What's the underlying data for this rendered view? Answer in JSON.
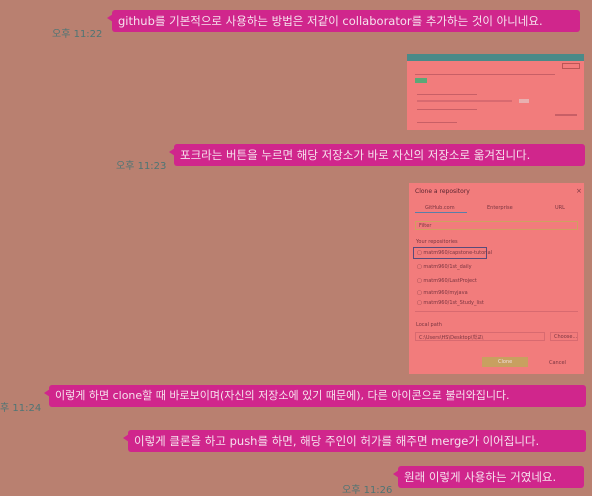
{
  "messages": [
    {
      "time": "오후 11:22",
      "text": "github를 기본적으로 사용하는 방법은 저같이 collaborator를 추가하는 것이 아니네요."
    },
    {
      "time": "오후 11:23",
      "text": "포크라는 버튼을 누르면 해당 저장소가 바로 자신의 저장소로 옮겨집니다."
    },
    {
      "time": "후 11:24",
      "text": "이렇게 하면 clone할 때 바로보이며(자신의 저장소에 있기 때문에), 다른 아이콘으로 불러와집니다."
    },
    {
      "text": "이렇게 클론을 하고 push를 하면, 해당 주인이 허가를 해주면 merge가 이어집니다."
    },
    {
      "time": "오후 11:26",
      "text": "원래 이렇게 사용하는 거였네요."
    }
  ],
  "clone_dialog": {
    "title": "Clone a repository",
    "close": "×",
    "tabs": [
      "GitHub.com",
      "Enterprise",
      "URL"
    ],
    "filter": "Filter",
    "section": "Your repositories",
    "repos": [
      "matm960/capstone-tutorial",
      "matm960/1st_daily",
      "matm960/LastProject",
      "matm960/myjava",
      "matm960/1st_Study_list"
    ],
    "local_path_label": "Local path",
    "local_path": "C:\\Users\\HS\\Desktop\\학교\\",
    "choose": "Choose...",
    "clone_btn": "Clone",
    "cancel_btn": "Cancel"
  }
}
